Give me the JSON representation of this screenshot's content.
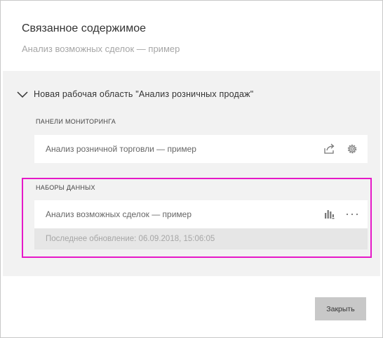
{
  "dialog": {
    "title": "Связанное содержимое",
    "subtitle": "Анализ возможных сделок — пример"
  },
  "workspace": {
    "label": "Новая  рабочая  область  \"Анализ  розничных  продаж\"",
    "expanded": true,
    "icon": "chevron-down-icon"
  },
  "dashboards": {
    "header": "ПАНЕЛИ МОНИТОРИНГА",
    "items": [
      {
        "label": "Анализ розничной торговли — пример",
        "icons": [
          "share-icon",
          "gear-icon"
        ]
      }
    ]
  },
  "datasets": {
    "header": "НАБОРЫ ДАННЫХ",
    "items": [
      {
        "label": "Анализ возможных сделок — пример",
        "icons": [
          "create-report-icon",
          "more-options-icon"
        ],
        "refresh": "Последнее обновление: 06.09.2018, 15:06:05"
      }
    ]
  },
  "footer": {
    "close_label": "Закрыть"
  },
  "colors": {
    "highlight": "#e619c8",
    "panel_bg": "#f2f2f2",
    "button_bg": "#c8c8c8"
  }
}
